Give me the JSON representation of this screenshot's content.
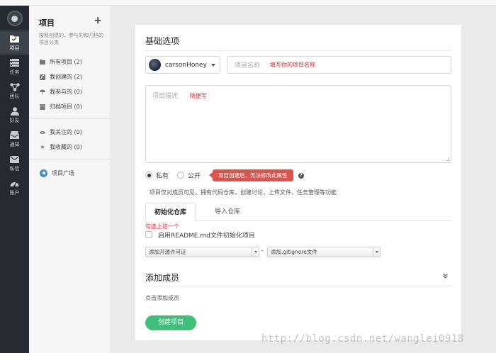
{
  "nav": {
    "items": [
      {
        "label": "项目",
        "icon": "folder-icon",
        "active": true
      },
      {
        "label": "任务",
        "icon": "task-list-icon",
        "active": false
      },
      {
        "label": "团队",
        "icon": "team-icon",
        "active": false
      },
      {
        "label": "好友",
        "icon": "user-icon",
        "active": false
      },
      {
        "label": "通知",
        "icon": "inbox-icon",
        "active": false
      },
      {
        "label": "私信",
        "icon": "mail-icon",
        "active": false
      },
      {
        "label": "账户",
        "icon": "dashboard-icon",
        "active": false
      }
    ]
  },
  "sidebar": {
    "title": "项目",
    "desc": "按我创建的、参与的和归档的项目分类",
    "items": [
      {
        "label": "所有项目 (2)",
        "icon": "folder-icon"
      },
      {
        "label": "我创建的 (2)",
        "icon": "edit-icon"
      },
      {
        "label": "我参与的 (0)",
        "icon": "umbrella-icon"
      },
      {
        "label": "归档项目 (0)",
        "icon": "archive-icon"
      }
    ],
    "items2": [
      {
        "label": "我关注的 (0)",
        "icon": "eye-icon"
      },
      {
        "label": "我收藏的 (0)",
        "icon": "star-icon"
      }
    ],
    "square": "项目广场"
  },
  "form": {
    "heading": "基础选项",
    "owner": "carsonHoney",
    "name_placeholder": "项目名称",
    "name_annotation": "填写你的项目名称",
    "desc_placeholder": "项目描述",
    "desc_annotation": "随便写",
    "private_label": "私有",
    "public_label": "公开",
    "visibility_tip": "项目创建后，无法修改此属性",
    "visibility_hint": "项目仅对成员可见，拥有代码仓库，创建讨论，上传文件，任务管理等功能",
    "tabs": [
      "初始化仓库",
      "导入仓库"
    ],
    "readme_annotation": "勾选上这一个",
    "readme_label": "启用README.md文件初始化项目",
    "license_select": "添加开源许可证",
    "gitignore_select": "添加.gitignore文件",
    "members_heading": "添加成员",
    "members_hint": "点击添加成员",
    "create_button": "创建项目"
  },
  "watermark": "http://blog.csdn.net/wanglei0918",
  "colors": {
    "nav_bg": "#262a30",
    "primary_green": "#3ec07a",
    "annotation_red": "#e02a2a",
    "tip_red": "#d9534f"
  }
}
